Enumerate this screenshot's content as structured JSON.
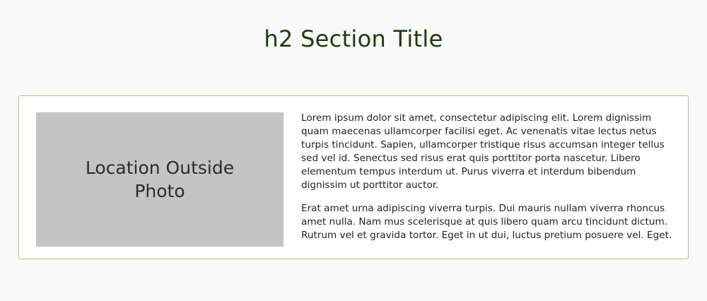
{
  "section": {
    "title": "h2 Section Title"
  },
  "card": {
    "photo_label": "Location Outside Photo",
    "paragraphs": [
      "Lorem ipsum dolor sit amet, consectetur adipiscing elit. Lorem dignissim quam maecenas ullamcorper facilisi eget. Ac venenatis vitae lectus netus turpis tincidunt. Sapien, ullamcorper tristique risus accumsan integer tellus sed vel id. Senectus sed risus erat quis porttitor porta nascetur. Libero elementum tempus interdum ut. Purus viverra et interdum bibendum dignissim ut porttitor auctor.",
      "Erat amet urna adipiscing viverra turpis. Dui mauris nullam viverra rhoncus amet nulla. Nam mus scelerisque at quis libero quam arcu tincidunt dictum. Rutrum vel et gravida tortor. Eget in ut dui, luctus pretium posuere vel. Eget."
    ]
  },
  "colors": {
    "page_background": "#f9f9f9",
    "title": "#1f3a0c",
    "card_border": "#b5b49a",
    "placeholder_fill": "#c4c4c4"
  }
}
